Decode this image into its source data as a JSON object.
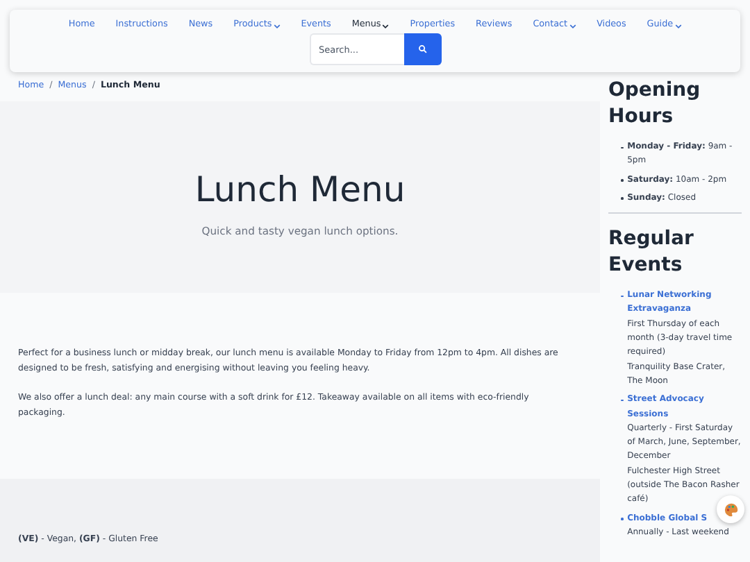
{
  "nav": {
    "items": [
      {
        "label": "Home",
        "dropdown": false,
        "selected": false
      },
      {
        "label": "Instructions",
        "dropdown": false,
        "selected": false
      },
      {
        "label": "News",
        "dropdown": false,
        "selected": false
      },
      {
        "label": "Products",
        "dropdown": true,
        "selected": false
      },
      {
        "label": "Events",
        "dropdown": false,
        "selected": false
      },
      {
        "label": "Menus",
        "dropdown": true,
        "selected": true
      },
      {
        "label": "Properties",
        "dropdown": false,
        "selected": false
      },
      {
        "label": "Reviews",
        "dropdown": false,
        "selected": false
      },
      {
        "label": "Contact",
        "dropdown": true,
        "selected": false
      },
      {
        "label": "Videos",
        "dropdown": false,
        "selected": false
      },
      {
        "label": "Guide",
        "dropdown": true,
        "selected": false
      }
    ],
    "search": {
      "placeholder": "Search..."
    }
  },
  "breadcrumb": {
    "items": [
      "Home",
      "Menus",
      "Lunch Menu"
    ],
    "separator": "/"
  },
  "hero": {
    "title": "Lunch Menu",
    "subtitle": "Quick and tasty vegan lunch options."
  },
  "intro": [
    "Perfect for a business lunch or midday break, our lunch menu is available Monday to Friday from 12pm to 4pm. All dishes are designed to be fresh, satisfying and energising without leaving you feeling heavy.",
    "We also offer a lunch deal: any main course with a soft drink for £12. Takeaway available on all items with eco-friendly packaging."
  ],
  "legend": "**(VE)** - Vegan, **(GF)** - Gluten Free",
  "sidebar": {
    "hours_title": "Opening Hours",
    "hours": [
      {
        "day": "Monday - Friday:",
        "time": "9am - 5pm"
      },
      {
        "day": "Saturday:",
        "time": "10am - 2pm"
      },
      {
        "day": "Sunday:",
        "time": "Closed"
      }
    ],
    "events_title": "Regular Events",
    "events": [
      {
        "title": "Lunar Networking Extravaganza",
        "lines": [
          "First Thursday of each month (3-day travel time required)",
          "Tranquility Base Crater, The Moon"
        ]
      },
      {
        "title": "Street Advocacy Sessions",
        "lines": [
          "Quarterly - First Saturday of March, June, September, December",
          "Fulchester High Street (outside The Bacon Rasher café)"
        ]
      },
      {
        "title": "Chobble Global S",
        "lines": [
          "Annually - Last weekend"
        ]
      }
    ]
  }
}
